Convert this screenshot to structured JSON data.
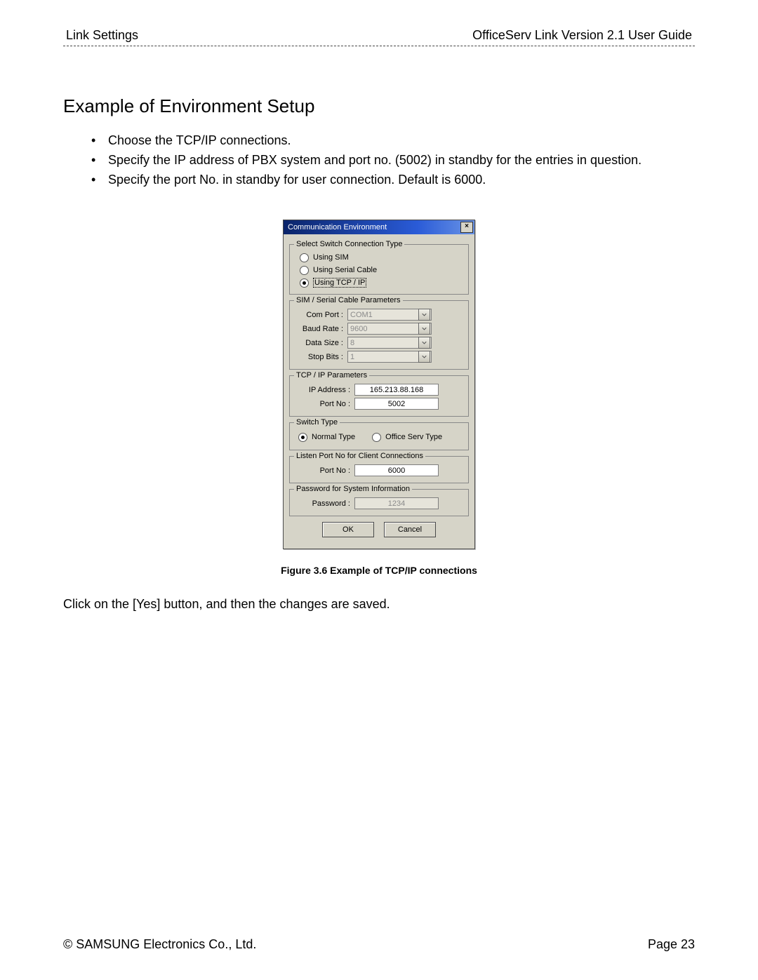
{
  "header": {
    "left": "Link Settings",
    "right": "OfficeServ Link Version 2.1 User Guide"
  },
  "section_title": "Example of Environment Setup",
  "bullets": [
    "Choose the TCP/IP connections.",
    "Specify the IP address of PBX system and port no. (5002) in standby for the entries in question.",
    "Specify the port No. in standby for user connection. Default is 6000."
  ],
  "dialog": {
    "title": "Communication Environment",
    "close_glyph": "×",
    "group_conn": {
      "legend": "Select Switch Connection Type",
      "opts": [
        {
          "label": "Using SIM",
          "checked": false
        },
        {
          "label": "Using Serial Cable",
          "checked": false
        },
        {
          "label": "Using TCP / IP",
          "checked": true,
          "focused": true
        }
      ]
    },
    "group_serial": {
      "legend": "SIM / Serial Cable Parameters",
      "rows": [
        {
          "label": "Com Port :",
          "value": "COM1"
        },
        {
          "label": "Baud Rate :",
          "value": "9600"
        },
        {
          "label": "Data Size :",
          "value": "8"
        },
        {
          "label": "Stop Bits :",
          "value": "1"
        }
      ]
    },
    "group_tcp": {
      "legend": "TCP / IP Parameters",
      "ip_label": "IP Address :",
      "ip_value": "165.213.88.168",
      "port_label": "Port No :",
      "port_value": "5002"
    },
    "group_switch": {
      "legend": "Switch Type",
      "normal": {
        "label": "Normal Type",
        "checked": true
      },
      "office": {
        "label": "Office Serv Type",
        "checked": false
      }
    },
    "group_listen": {
      "legend": "Listen Port No for Client Connections",
      "label": "Port No :",
      "value": "6000"
    },
    "group_pwd": {
      "legend": "Password for System Information",
      "label": "Password :",
      "value": "1234"
    },
    "buttons": {
      "ok": "OK",
      "cancel": "Cancel"
    }
  },
  "caption": "Figure 3.6 Example of TCP/IP connections",
  "post_text": "Click on the [Yes] button, and then the changes are saved.",
  "footer": {
    "left": "© SAMSUNG Electronics Co., Ltd.",
    "right": "Page 23"
  }
}
